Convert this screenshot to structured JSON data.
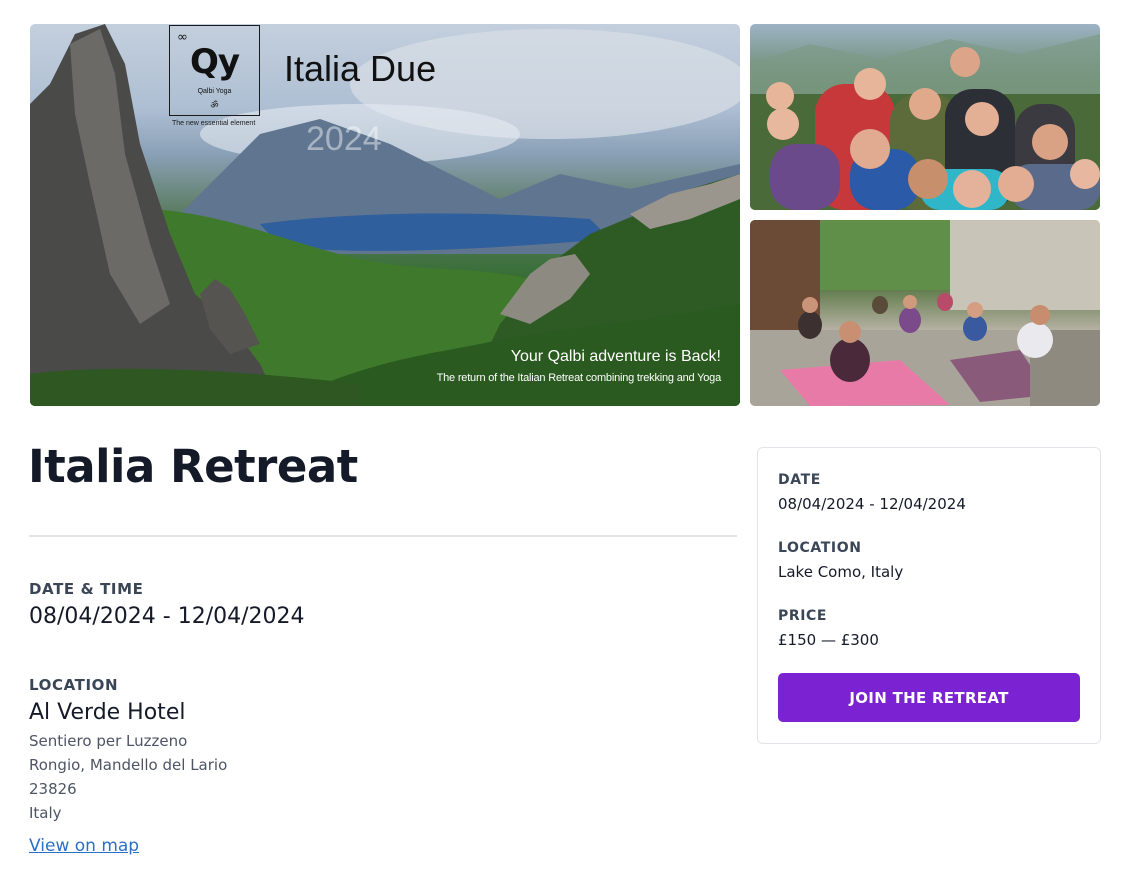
{
  "gallery": {
    "hero": {
      "logo_symbol": "Qy",
      "logo_infinity": "∞",
      "logo_name": "Qalbi Yoga",
      "logo_om": "ॐ",
      "logo_tagline": "The new essential element",
      "title": "Italia Due",
      "year": "2024",
      "tagline": "Your Qalbi adventure is Back!",
      "subtitle": "The return of the Italian Retreat combining trekking and Yoga"
    }
  },
  "event": {
    "title": "Italia Retreat",
    "datetime_label": "DATE & TIME",
    "datetime_value": "08/04/2024 - 12/04/2024",
    "location_label": "LOCATION",
    "location_name": "Al Verde Hotel",
    "address": [
      "Sentiero per Luzzeno",
      "Rongio, Mandello del Lario",
      "23826",
      "Italy"
    ],
    "map_link": "View on map"
  },
  "card": {
    "date_label": "DATE",
    "date_value": "08/04/2024 - 12/04/2024",
    "location_label": "LOCATION",
    "location_value": "Lake Como, Italy",
    "price_label": "PRICE",
    "price_value": "£150 — £300",
    "button_label": "JOIN THE RETREAT"
  },
  "colors": {
    "accent": "#7b22d2",
    "link": "#2a6fc9",
    "heading": "#141a28"
  }
}
